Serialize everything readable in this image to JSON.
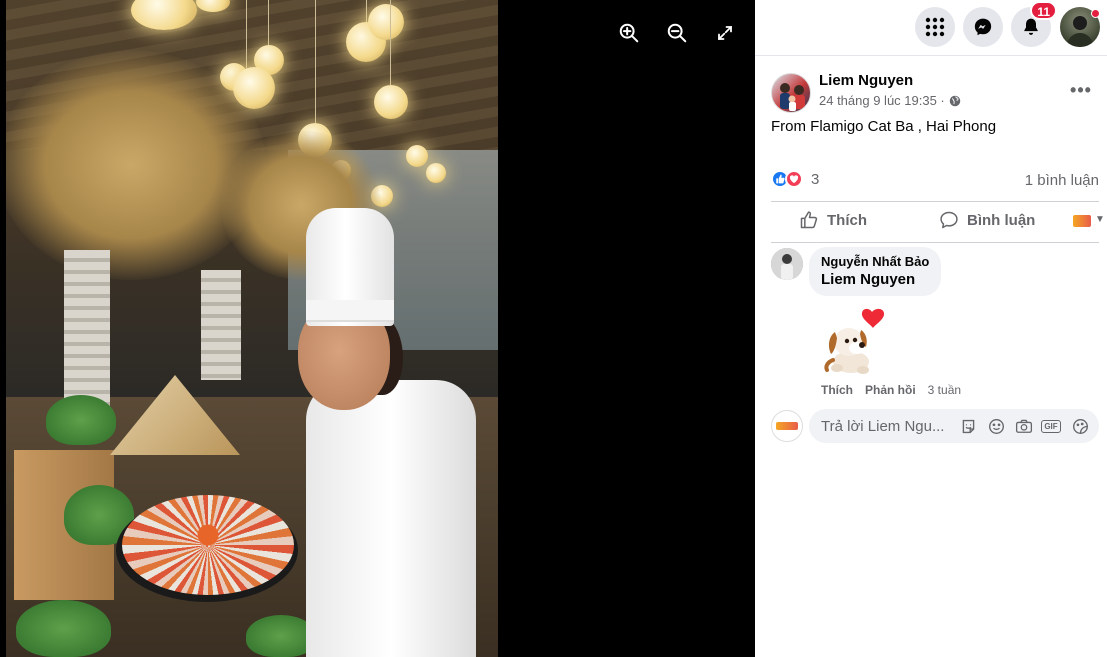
{
  "viewer": {
    "tools": [
      {
        "name": "zoom-in-icon"
      },
      {
        "name": "zoom-out-icon"
      },
      {
        "name": "fullscreen-icon"
      }
    ]
  },
  "topbar": {
    "icons": [
      "menu-grid-icon",
      "messenger-icon",
      "bell-icon"
    ],
    "notifications_count": "11"
  },
  "post": {
    "author": "Liem Nguyen",
    "timestamp": "24 tháng 9 lúc 19:35 ·",
    "privacy_icon": "globe-icon",
    "text": "From Flamigo Cat Ba , Hai Phong",
    "reaction_count": "3",
    "comment_count": "1 bình luận",
    "actions": {
      "like": "Thích",
      "comment": "Bình luận"
    }
  },
  "comment": {
    "author": "Nguyễn Nhất Bảo",
    "text": "Liem Nguyen",
    "sticker": "puppy-heart-sticker",
    "like": "Thích",
    "reply": "Phản hồi",
    "age": "3 tuần"
  },
  "reply": {
    "placeholder": "Trả lời Liem Ngu..."
  },
  "colors": {
    "accent": "#1877f2",
    "love": "#f33e58",
    "badge": "#e41e3f",
    "text_secondary": "#65676b",
    "bubble": "#f0f2f5"
  }
}
